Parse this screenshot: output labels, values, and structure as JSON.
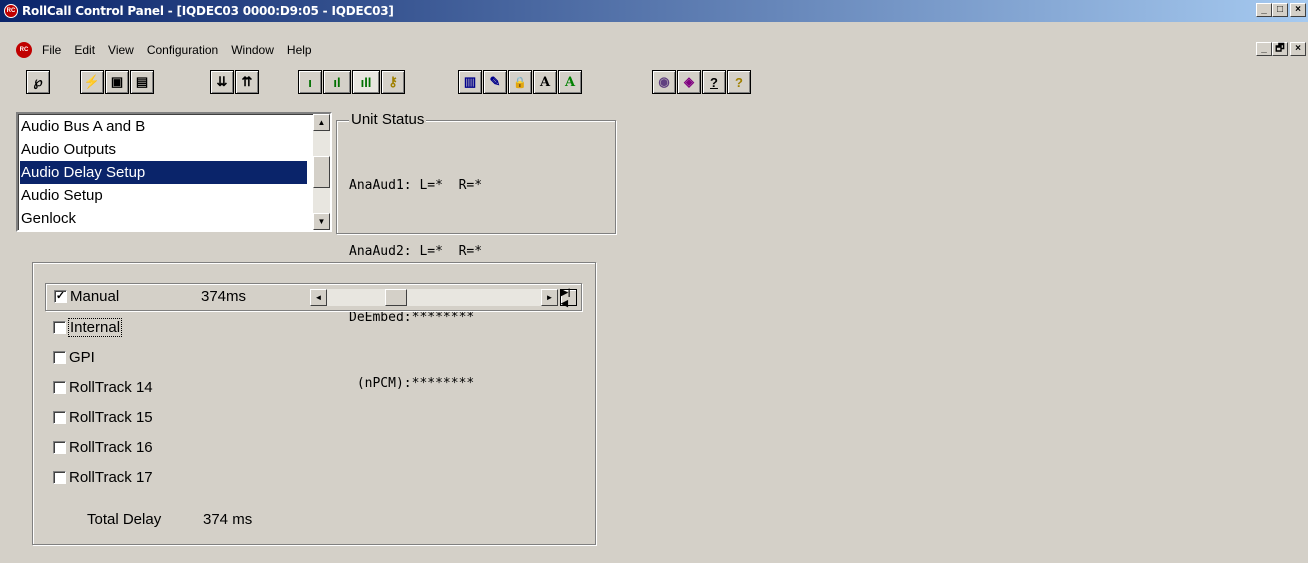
{
  "window": {
    "title": "RollCall Control Panel - [IQDEC03 0000:D9:05 - IQDEC03]",
    "minimize_glyph": "_",
    "maximize_glyph": "□",
    "restore_glyph": "🗗",
    "close_glyph": "×"
  },
  "menu": {
    "items": [
      "File",
      "Edit",
      "View",
      "Configuration",
      "Window",
      "Help"
    ]
  },
  "toolbar": {
    "buttons": [
      {
        "name": "connect-icon",
        "glyph": "℘"
      },
      {
        "name": "lightning-icon",
        "glyph": "⚡"
      },
      {
        "name": "save-icon",
        "glyph": "▣"
      },
      {
        "name": "save-all-icon",
        "glyph": "▤"
      },
      {
        "name": "download-icon",
        "glyph": "⇊"
      },
      {
        "name": "upload-icon",
        "glyph": "⇈"
      },
      {
        "name": "level-low-icon",
        "glyph": "ı"
      },
      {
        "name": "level-mid-icon",
        "glyph": "ıl"
      },
      {
        "name": "level-high-icon",
        "glyph": "ıll"
      },
      {
        "name": "key-icon",
        "glyph": "⚷"
      },
      {
        "name": "book-icon",
        "glyph": "▥"
      },
      {
        "name": "edit-icon",
        "glyph": "✎"
      },
      {
        "name": "lock-icon",
        "glyph": "🔒"
      },
      {
        "name": "font-a-icon",
        "glyph": "A"
      },
      {
        "name": "font-green-a-icon",
        "glyph": "A"
      },
      {
        "name": "globe-icon",
        "glyph": "◉"
      },
      {
        "name": "disc-icon",
        "glyph": "◈"
      },
      {
        "name": "help-topics-icon",
        "glyph": "?"
      },
      {
        "name": "help-icon",
        "glyph": "?"
      }
    ]
  },
  "list": {
    "items": [
      "Audio Bus A and B",
      "Audio Outputs",
      "Audio Delay Setup",
      "Audio Setup",
      "Genlock"
    ],
    "selected_index": 2
  },
  "unit_status": {
    "legend": "Unit Status",
    "lines": [
      "AnaAud1: L=*  R=*",
      "AnaAud2: L=*  R=*",
      "DeEmbed:********",
      " (nPCM):********"
    ]
  },
  "delay": {
    "manual": {
      "label": "Manual",
      "checked": true,
      "value": "374ms"
    },
    "slider": {
      "left_glyph": "◄",
      "right_glyph": "►",
      "end_glyph": "▶|◀",
      "fraction": 0.3
    },
    "options": [
      {
        "label": "Internal",
        "checked": false
      },
      {
        "label": "GPI",
        "checked": false
      },
      {
        "label": "RollTrack 14",
        "checked": false
      },
      {
        "label": "RollTrack 15",
        "checked": false
      },
      {
        "label": "RollTrack 16",
        "checked": false
      },
      {
        "label": "RollTrack 17",
        "checked": false
      }
    ],
    "total_label": "Total Delay",
    "total_value": "374 ms"
  },
  "colors": {
    "title_start": "#0a246a",
    "title_end": "#a6caf0",
    "face": "#d4d0c8",
    "selection": "#0a246a"
  }
}
